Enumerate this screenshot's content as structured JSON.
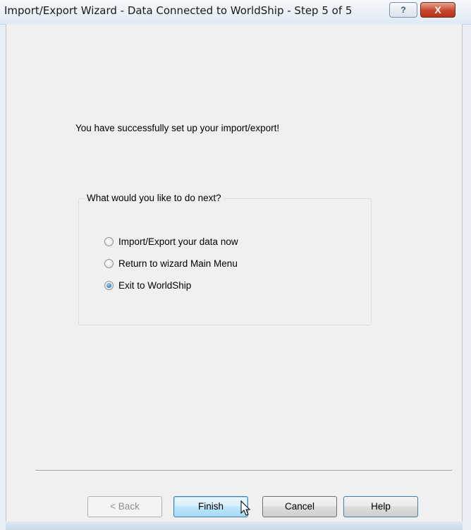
{
  "window": {
    "title": "Import/Export Wizard - Data Connected to WorldShip - Step 5 of 5",
    "help_icon": "help-question-icon",
    "close_icon": "close-x-icon",
    "help_glyph": "?",
    "close_glyph": "X"
  },
  "main": {
    "success_message": "You have successfully set up your import/export!",
    "group": {
      "legend": "What would you like to do next?",
      "options": [
        {
          "label": "Import/Export your data now",
          "checked": false
        },
        {
          "label": "Return to wizard Main Menu",
          "checked": false
        },
        {
          "label": "Exit to WorldShip",
          "checked": true
        }
      ]
    }
  },
  "buttons": {
    "back": "< Back",
    "finish": "Finish",
    "cancel": "Cancel",
    "help": "Help"
  },
  "colors": {
    "dialog_bg": "#f0f0f0",
    "title_bg": "#dfe9f4",
    "close_button": "#c8452c",
    "default_button": "#bee6fd"
  }
}
